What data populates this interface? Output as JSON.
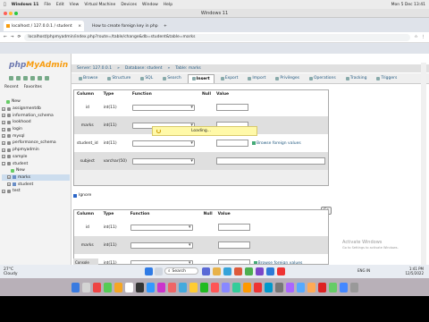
{
  "mac": {
    "apple_icon": "apple-icon",
    "menus": [
      "Windows 11",
      "File",
      "Edit",
      "View",
      "Virtual Machine",
      "Devices",
      "Window",
      "Help"
    ],
    "status_right": "Mon 5 Dec  13:41"
  },
  "vm_title": "Windows 11",
  "browser": {
    "tabs": [
      {
        "label": "localhost / 127.0.0.1 / student"
      },
      {
        "label": "How to create foreign key in php"
      }
    ],
    "new_tab": "+",
    "url": "localhost/phpmyadmin/index.php?route=/table/change&db=student&table=marks"
  },
  "sidebar": {
    "logo_php": "php",
    "logo_admin": "MyAdmin",
    "tabs": [
      "Recent",
      "Favorites"
    ],
    "tree": [
      {
        "label": "New",
        "kind": "new"
      },
      {
        "label": "assignmentdb",
        "kind": "db"
      },
      {
        "label": "information_schema",
        "kind": "db"
      },
      {
        "label": "lookhood",
        "kind": "db"
      },
      {
        "label": "login",
        "kind": "db"
      },
      {
        "label": "mysql",
        "kind": "db"
      },
      {
        "label": "performance_schema",
        "kind": "db"
      },
      {
        "label": "phpmyadmin",
        "kind": "db"
      },
      {
        "label": "sample",
        "kind": "db"
      },
      {
        "label": "student",
        "kind": "db-open"
      },
      {
        "label": "New",
        "kind": "new-sub"
      },
      {
        "label": "marks",
        "kind": "table-active"
      },
      {
        "label": "student",
        "kind": "table"
      },
      {
        "label": "test",
        "kind": "db"
      }
    ]
  },
  "breadcrumb": {
    "server": "Server: 127.0.0.1",
    "database": "Database: student",
    "table": "Table: marks"
  },
  "navtabs": [
    "Browse",
    "Structure",
    "SQL",
    "Search",
    "Insert",
    "Export",
    "Import",
    "Privileges",
    "Operations",
    "Tracking",
    "Triggers"
  ],
  "active_tab": "Insert",
  "form": {
    "headers": [
      "Column",
      "Type",
      "Function",
      "Null",
      "Value"
    ],
    "rows1": [
      {
        "column": "id",
        "type": "int(11)",
        "browse": ""
      },
      {
        "column": "marks",
        "type": "int(11)",
        "browse": ""
      },
      {
        "column": "student_id",
        "type": "int(11)",
        "browse": "Browse foreign values"
      },
      {
        "column": "subject",
        "type": "varchar(50)",
        "browse": ""
      }
    ],
    "go_label": "Go",
    "ignore_label": "Ignore",
    "rows2": [
      {
        "column": "id",
        "type": "int(11)",
        "browse": ""
      },
      {
        "column": "marks",
        "type": "int(11)",
        "browse": ""
      },
      {
        "column": "student_id",
        "type": "int(11)",
        "browse": "Browse foreign values"
      }
    ]
  },
  "loading_text": "Loading...",
  "console_label": "Console",
  "activate": {
    "title": "Activate Windows",
    "sub": "Go to Settings to activate Windows."
  },
  "taskbar": {
    "weather_temp": "27°C",
    "weather_desc": "Cloudy",
    "search": "Search",
    "lang": "ENG IN",
    "time": "1:41 PM",
    "date": "12/5/2022"
  }
}
